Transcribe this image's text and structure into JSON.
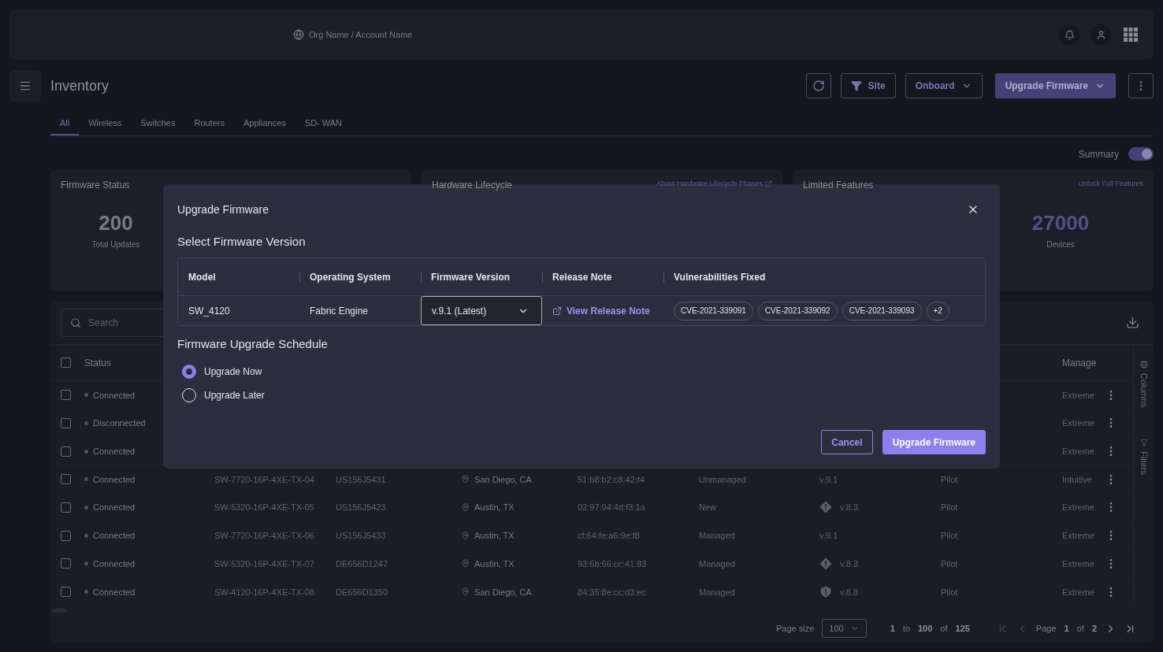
{
  "topbar": {
    "account": "Org Name / Account Name"
  },
  "page": {
    "title": "Inventory"
  },
  "actions": [
    {
      "kind": "refresh"
    },
    {
      "kind": "filter",
      "label": "Site"
    },
    {
      "kind": "dropdown",
      "label": "Onboard"
    },
    {
      "kind": "primary",
      "label": "Upgrade Firmware"
    },
    {
      "kind": "more"
    }
  ],
  "tabs": [
    {
      "label": "All",
      "selected": true
    },
    {
      "label": "Wireless",
      "selected": false
    },
    {
      "label": "Switches",
      "selected": false
    },
    {
      "label": "Routers",
      "selected": false
    },
    {
      "label": "Appliances",
      "selected": false
    },
    {
      "label": "SD- WAN",
      "selected": false
    }
  ],
  "summary": {
    "label": "Summary",
    "on": true
  },
  "cards": [
    {
      "title": "Firmware Status",
      "stats": [
        {
          "value": "200",
          "label": "Total Updates"
        }
      ]
    },
    {
      "title": "Hardware Lifecycle",
      "link": "About Hardware Lifecycle Phases",
      "link_external": true
    },
    {
      "title": "Limited Features",
      "link": "Unlock Full Features",
      "link_external": false,
      "stats": [
        {
          "value": "27000",
          "label": "Devices"
        }
      ]
    }
  ],
  "table": {
    "search_placeholder": "Search",
    "all_checked": false,
    "columns": [
      {
        "label": "Status"
      },
      {
        "label": "Manage"
      }
    ],
    "rows": [
      {
        "checked": false,
        "status": "Connected",
        "manage": "Extreme"
      },
      {
        "checked": false,
        "status": "Disconnected",
        "manage": "Extreme"
      },
      {
        "checked": false,
        "status": "Connected",
        "manage": "Extreme"
      },
      {
        "checked": false,
        "status": "Connected",
        "name": "SW-7720-16P-4XE-TX-04",
        "serial": "US156J5431",
        "location": "San Diego, CA",
        "mac": "51:b8:b2:c8:42:f4",
        "state": "Unmanaged",
        "firmware": "v.9.1",
        "kind": "ok",
        "plan": "Pilot",
        "manage": "Intuitive"
      },
      {
        "checked": false,
        "status": "Connected",
        "name": "SW-5320-16P-4XE-TX-05",
        "serial": "US156J5423",
        "location": "Austin, TX",
        "mac": "02:97:94:4d:f3:1a",
        "state": "New",
        "firmware": "v.8.3",
        "kind": "warning",
        "plan": "Pilot",
        "manage": "Extreme"
      },
      {
        "checked": false,
        "status": "Connected",
        "name": "SW-7720-16P-4XE-TX-06",
        "serial": "US156J5433",
        "location": "Austin, TX",
        "mac": "cf:64:fe:a6:9e:f8",
        "state": "Managed",
        "firmware": "v.9.1",
        "kind": "ok",
        "plan": "Pilot",
        "manage": "Extreme"
      },
      {
        "checked": false,
        "status": "Connected",
        "name": "SW-5320-16P-4XE-TX-07",
        "serial": "DE656D1247",
        "location": "Austin, TX",
        "mac": "93:6b:66:cc:41:83",
        "state": "Managed",
        "firmware": "v.8.3",
        "kind": "warning",
        "plan": "Pilot",
        "manage": "Extreme"
      },
      {
        "checked": false,
        "status": "Connected",
        "name": "SW-4120-16P-4XE-TX-08",
        "serial": "DE656D1350",
        "location": "San Diego, CA",
        "mac": "84:35:8e:cc:d3:ec",
        "state": "Managed",
        "firmware": "v.8.8",
        "kind": "critical",
        "plan": "Pilot",
        "manage": "Extreme"
      }
    ]
  },
  "side_tabs": [
    {
      "kind": "columns",
      "label": "Columns"
    },
    {
      "kind": "filters",
      "label": "Filters"
    }
  ],
  "pagination": {
    "page_size_label": "Page size",
    "page_size": "100",
    "from": "1",
    "to_word": "to",
    "to": "100",
    "of_word": "of",
    "total": "125",
    "page_word": "Page",
    "page": "1",
    "pages_of_word": "of",
    "pages": "2"
  },
  "dialog": {
    "title": "Upgrade Firmware",
    "section": "Select Firmware Version",
    "columns": [
      "Model",
      "Operating System",
      "Firmware Version",
      "Release Note",
      "Vulnerabilities Fixed"
    ],
    "row": {
      "model": "SW_4120",
      "os": "Fabric Engine",
      "version": "v.9.1 (Latest)",
      "release_link": "View Release Note",
      "cves": [
        "CVE-2021-339091",
        "CVE-2021-339092",
        "CVE-2021-339093",
        "+2"
      ]
    },
    "schedule_title": "Firmware Upgrade Schedule",
    "options": [
      {
        "label": "Upgrade Now",
        "selected": true
      },
      {
        "label": "Upgrade Later",
        "selected": false
      }
    ],
    "buttons": [
      {
        "kind": "secondary",
        "label": "Cancel"
      },
      {
        "kind": "primary",
        "label": "Upgrade Firmware"
      }
    ]
  }
}
